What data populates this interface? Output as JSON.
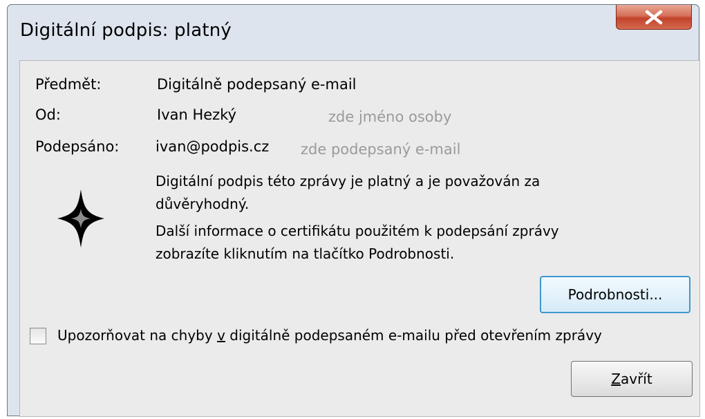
{
  "window": {
    "title": "Digitální podpis: platný",
    "close_icon": "close-icon"
  },
  "info": {
    "subject_label": "Předmět:",
    "subject_value": "Digitálně podepsaný e-mail",
    "from_label": "Od:",
    "from_value": "Ivan Hezký",
    "from_hint": "zde jméno osoby",
    "signed_label": "Podepsáno:",
    "signed_value": "ivan@podpis.cz",
    "signed_hint": "zde podepsaný e-mail"
  },
  "message": {
    "line1": "Digitální podpis této zprávy je platný a je považován za",
    "line2": "důvěryhodný.",
    "line3": "Další informace o certifikátu použitém k podepsání zprávy",
    "line4": "zobrazíte kliknutím na tlačítko Podrobnosti.",
    "icon": "signature-star-icon"
  },
  "buttons": {
    "details_label": "Podrobnosti...",
    "close_label_prefix": "",
    "close_label_accel": "Z",
    "close_label_rest": "avřít"
  },
  "checkbox": {
    "label_before": "Upozorňovat na chyby ",
    "label_accel": "v",
    "label_after": " digitálně podepsaném e-mailu před otevřením zprávy",
    "checked": false
  }
}
